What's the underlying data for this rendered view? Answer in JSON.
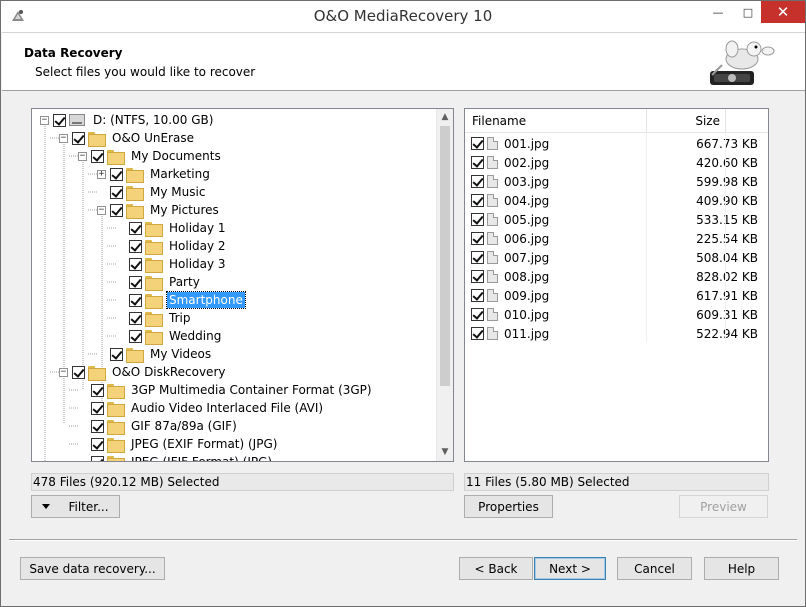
{
  "window": {
    "title": "O&O MediaRecovery 10",
    "minimize_glyph": "—",
    "maximize_glyph": "□",
    "close_glyph": "✕"
  },
  "header": {
    "title": "Data Recovery",
    "subtitle": "Select files you would like to recover"
  },
  "tree": {
    "items": [
      {
        "label": "D: (NTFS, 10.00 GB)",
        "expander": "−",
        "icon": "drive-icon"
      },
      {
        "label": "O&O UnErase",
        "expander": "−",
        "icon": "folder-icon"
      },
      {
        "label": "My Documents",
        "expander": "−",
        "icon": "folder-icon"
      },
      {
        "label": "Marketing",
        "expander": "+",
        "icon": "folder-icon"
      },
      {
        "label": "My Music",
        "expander": "",
        "icon": "folder-icon"
      },
      {
        "label": "My Pictures",
        "expander": "−",
        "icon": "folder-icon"
      },
      {
        "label": "Holiday 1",
        "expander": "",
        "icon": "folder-icon"
      },
      {
        "label": "Holiday 2",
        "expander": "",
        "icon": "folder-icon"
      },
      {
        "label": "Holiday 3",
        "expander": "",
        "icon": "folder-icon"
      },
      {
        "label": "Party",
        "expander": "",
        "icon": "folder-icon"
      },
      {
        "label": "Smartphone",
        "expander": "",
        "icon": "folder-icon",
        "selected": true
      },
      {
        "label": "Trip",
        "expander": "",
        "icon": "folder-icon"
      },
      {
        "label": "Wedding",
        "expander": "",
        "icon": "folder-icon"
      },
      {
        "label": "My Videos",
        "expander": "",
        "icon": "folder-icon"
      },
      {
        "label": "O&O DiskRecovery",
        "expander": "−",
        "icon": "folder-icon"
      },
      {
        "label": "3GP Multimedia Container Format (3GP)",
        "expander": "",
        "icon": "folder-icon"
      },
      {
        "label": "Audio Video Interlaced File (AVI)",
        "expander": "",
        "icon": "folder-icon"
      },
      {
        "label": "GIF 87a/89a (GIF)",
        "expander": "",
        "icon": "folder-icon"
      },
      {
        "label": "JPEG (EXIF Format) (JPG)",
        "expander": "",
        "icon": "folder-icon"
      },
      {
        "label": "JPEG (JFIF Format) (JPG)",
        "expander": "",
        "icon": "folder-icon"
      }
    ]
  },
  "file_list": {
    "columns": [
      "Filename",
      "Size"
    ],
    "rows": [
      {
        "name": "001.jpg",
        "size": "667.73 KB"
      },
      {
        "name": "002.jpg",
        "size": "420.60 KB"
      },
      {
        "name": "003.jpg",
        "size": "599.98 KB"
      },
      {
        "name": "004.jpg",
        "size": "409.90 KB"
      },
      {
        "name": "005.jpg",
        "size": "533.15 KB"
      },
      {
        "name": "006.jpg",
        "size": "225.54 KB"
      },
      {
        "name": "007.jpg",
        "size": "508.04 KB"
      },
      {
        "name": "008.jpg",
        "size": "828.02 KB"
      },
      {
        "name": "009.jpg",
        "size": "617.91 KB"
      },
      {
        "name": "010.jpg",
        "size": "609.31 KB"
      },
      {
        "name": "011.jpg",
        "size": "522.94 KB"
      }
    ]
  },
  "status": {
    "left": "478 Files (920.12 MB) Selected",
    "right": "11 Files (5.80 MB) Selected"
  },
  "buttons": {
    "filter": "Filter...",
    "properties": "Properties",
    "preview": "Preview",
    "save": "Save data recovery...",
    "back": "< Back",
    "next": "Next >",
    "cancel": "Cancel",
    "help": "Help"
  },
  "colors": {
    "selection": "#3399ff",
    "close_button": "#c7312b"
  }
}
